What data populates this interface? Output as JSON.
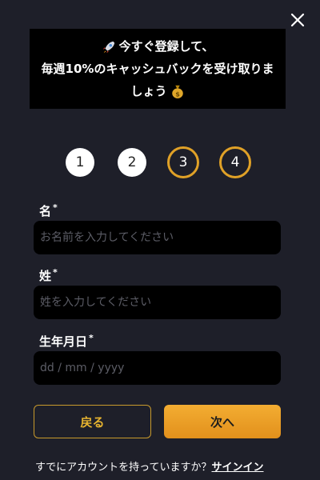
{
  "promo": {
    "line1": "今すぐ登録して、",
    "line2": "毎週10%のキャッシュバックを受け取りま",
    "line3": "しょう",
    "icons": [
      "rocket-icon",
      "money-bag-icon"
    ]
  },
  "steps": [
    {
      "label": "1",
      "state": "done"
    },
    {
      "label": "2",
      "state": "done"
    },
    {
      "label": "3",
      "state": "todo"
    },
    {
      "label": "4",
      "state": "todo"
    }
  ],
  "form": {
    "first_name": {
      "label": "名",
      "required_mark": "*",
      "placeholder": "お名前を入力してください",
      "value": ""
    },
    "last_name": {
      "label": "姓",
      "required_mark": "*",
      "placeholder": "姓を入力してください",
      "value": ""
    },
    "birthdate": {
      "label": "生年月日",
      "required_mark": "*",
      "placeholder": "dd / mm / yyyy",
      "value": ""
    }
  },
  "buttons": {
    "back": "戻る",
    "next": "次へ"
  },
  "footer": {
    "prompt": "すでにアカウントを持っていますか？",
    "signin": "サインイン"
  },
  "colors": {
    "background": "#1e1f29",
    "accent": "#e6a72a",
    "input_bg": "#000000"
  }
}
